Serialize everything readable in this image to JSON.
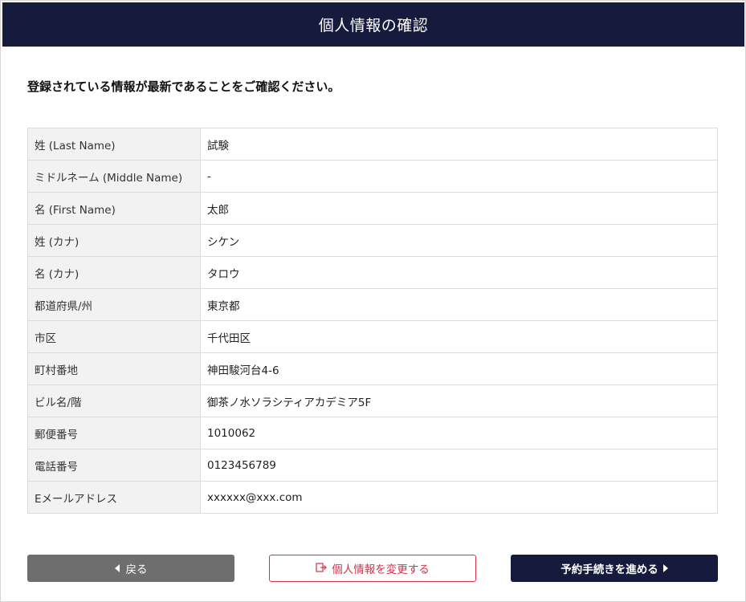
{
  "header": {
    "title": "個人情報の確認"
  },
  "intro": {
    "text": "登録されている情報が最新であることをご確認ください。"
  },
  "rows": [
    {
      "label": "姓 (Last Name)",
      "value": "試験"
    },
    {
      "label": "ミドルネーム (Middle Name)",
      "value": "-"
    },
    {
      "label": "名 (First Name)",
      "value": "太郎"
    },
    {
      "label": "姓 (カナ)",
      "value": "シケン"
    },
    {
      "label": "名 (カナ)",
      "value": "タロウ"
    },
    {
      "label": "都道府県/州",
      "value": "東京都"
    },
    {
      "label": "市区",
      "value": "千代田区"
    },
    {
      "label": "町村番地",
      "value": "神田駿河台4-6"
    },
    {
      "label": "ビル名/階",
      "value": "御茶ノ水ソラシティアカデミア5F"
    },
    {
      "label": "郵便番号",
      "value": "1010062"
    },
    {
      "label": "電話番号",
      "value": "0123456789"
    },
    {
      "label": "Eメールアドレス",
      "value": "xxxxxx@xxx.com"
    }
  ],
  "buttons": {
    "back_label": "戻る",
    "edit_label": "個人情報を変更する",
    "next_label": "予約手続きを進める"
  },
  "colors": {
    "header_bg": "#161a3c",
    "edit_accent": "#d9304a",
    "back_bg": "#6e6e6e"
  },
  "icons": {
    "back": "triangle-left-icon",
    "edit": "edit-icon",
    "next": "triangle-right-icon"
  }
}
